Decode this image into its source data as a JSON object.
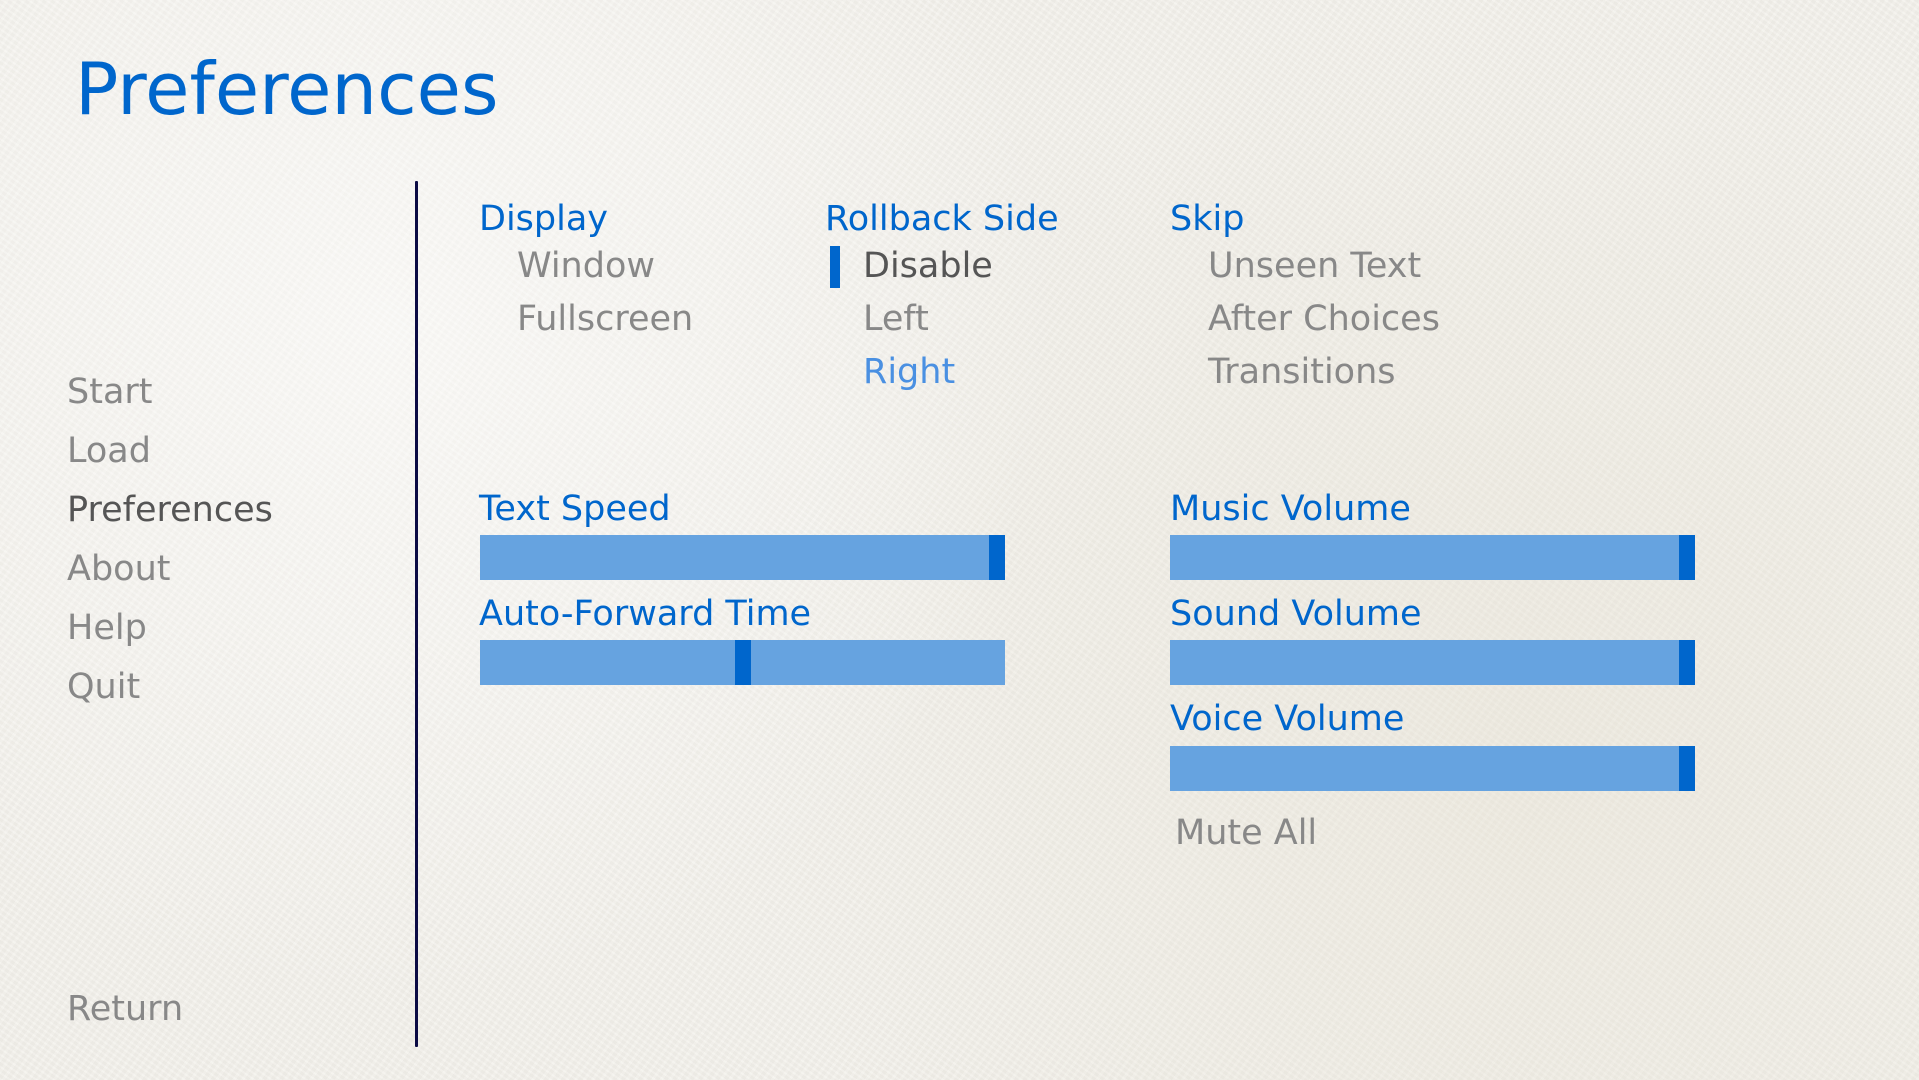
{
  "title": "Preferences",
  "nav": {
    "items": [
      {
        "label": "Start",
        "selected": false
      },
      {
        "label": "Load",
        "selected": false
      },
      {
        "label": "Preferences",
        "selected": true
      },
      {
        "label": "About",
        "selected": false
      },
      {
        "label": "Help",
        "selected": false
      },
      {
        "label": "Quit",
        "selected": false
      }
    ],
    "return_label": "Return"
  },
  "display": {
    "header": "Display",
    "options": [
      "Window",
      "Fullscreen"
    ]
  },
  "rollback": {
    "header": "Rollback Side",
    "options": [
      "Disable",
      "Left",
      "Right"
    ],
    "selected": "Disable",
    "hovered": "Right"
  },
  "skip": {
    "header": "Skip",
    "options": [
      "Unseen Text",
      "After Choices",
      "Transitions"
    ]
  },
  "sliders": {
    "text_speed": {
      "label": "Text Speed",
      "value": 1.0
    },
    "auto_forward": {
      "label": "Auto-Forward Time",
      "value": 0.5
    },
    "music_volume": {
      "label": "Music Volume",
      "value": 1.0
    },
    "sound_volume": {
      "label": "Sound Volume",
      "value": 1.0
    },
    "voice_volume": {
      "label": "Voice Volume",
      "value": 1.0
    }
  },
  "mute_all_label": "Mute All",
  "colors": {
    "accent": "#0066cc",
    "bar": "#66a3e0",
    "idle_text": "#888888",
    "selected_text": "#555555",
    "hover_text": "#4a90e2",
    "divider": "#0b0b44"
  }
}
